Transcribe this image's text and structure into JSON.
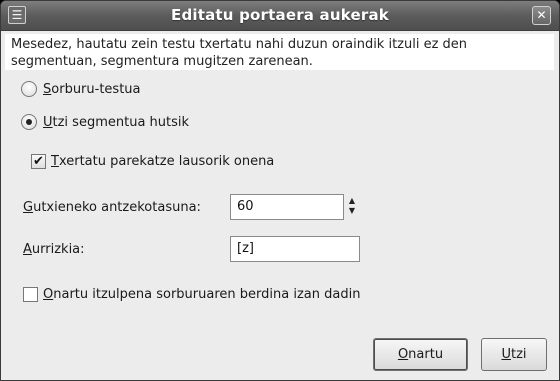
{
  "window": {
    "title": "Editatu portaera aukerak",
    "icon": "menu-icon",
    "close_glyph": "✕"
  },
  "message": "Mesedez, hautatu zein testu txertatu nahi duzun oraindik itzuli ez den segmentuan, segmentura mugitzen zarenean.",
  "options": {
    "source_text": {
      "mnemonic": "S",
      "rest": "orburu-testua",
      "selected": false
    },
    "leave_empty": {
      "mnemonic": "U",
      "rest": "tzi segmentua hutsik",
      "selected": true
    },
    "insert_fuzzy": {
      "mnemonic": "T",
      "rest": "xertatu parekatze lausorik onena",
      "checked": true
    }
  },
  "min_similarity": {
    "label_mnemonic": "G",
    "label_rest": "utxieneko antzekotasuna:",
    "value": "60"
  },
  "prefix": {
    "label_mnemonic": "A",
    "label_rest": "urrizkia:",
    "value": "[z]"
  },
  "accept_same_as_source": {
    "mnemonic": "O",
    "rest": "nartu itzulpena sorburuaren berdina izan dadin",
    "checked": false
  },
  "buttons": {
    "ok": {
      "mnemonic": "O",
      "rest": "nartu"
    },
    "cancel": {
      "mnemonic": "U",
      "rest": "tzi"
    }
  }
}
